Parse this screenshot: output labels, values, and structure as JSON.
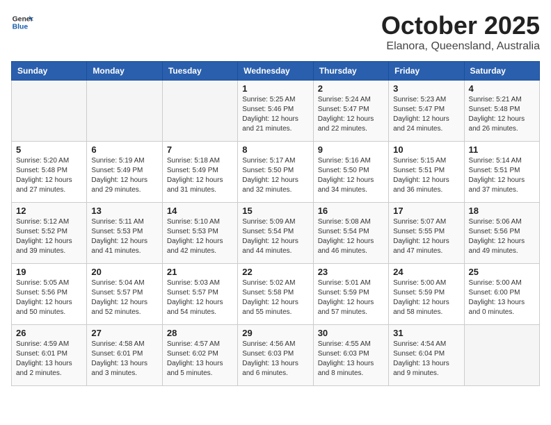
{
  "header": {
    "logo_general": "General",
    "logo_blue": "Blue",
    "month": "October 2025",
    "location": "Elanora, Queensland, Australia"
  },
  "weekdays": [
    "Sunday",
    "Monday",
    "Tuesday",
    "Wednesday",
    "Thursday",
    "Friday",
    "Saturday"
  ],
  "weeks": [
    [
      {
        "day": "",
        "sunrise": "",
        "sunset": "",
        "daylight": ""
      },
      {
        "day": "",
        "sunrise": "",
        "sunset": "",
        "daylight": ""
      },
      {
        "day": "",
        "sunrise": "",
        "sunset": "",
        "daylight": ""
      },
      {
        "day": "1",
        "sunrise": "Sunrise: 5:25 AM",
        "sunset": "Sunset: 5:46 PM",
        "daylight": "Daylight: 12 hours and 21 minutes."
      },
      {
        "day": "2",
        "sunrise": "Sunrise: 5:24 AM",
        "sunset": "Sunset: 5:47 PM",
        "daylight": "Daylight: 12 hours and 22 minutes."
      },
      {
        "day": "3",
        "sunrise": "Sunrise: 5:23 AM",
        "sunset": "Sunset: 5:47 PM",
        "daylight": "Daylight: 12 hours and 24 minutes."
      },
      {
        "day": "4",
        "sunrise": "Sunrise: 5:21 AM",
        "sunset": "Sunset: 5:48 PM",
        "daylight": "Daylight: 12 hours and 26 minutes."
      }
    ],
    [
      {
        "day": "5",
        "sunrise": "Sunrise: 5:20 AM",
        "sunset": "Sunset: 5:48 PM",
        "daylight": "Daylight: 12 hours and 27 minutes."
      },
      {
        "day": "6",
        "sunrise": "Sunrise: 5:19 AM",
        "sunset": "Sunset: 5:49 PM",
        "daylight": "Daylight: 12 hours and 29 minutes."
      },
      {
        "day": "7",
        "sunrise": "Sunrise: 5:18 AM",
        "sunset": "Sunset: 5:49 PM",
        "daylight": "Daylight: 12 hours and 31 minutes."
      },
      {
        "day": "8",
        "sunrise": "Sunrise: 5:17 AM",
        "sunset": "Sunset: 5:50 PM",
        "daylight": "Daylight: 12 hours and 32 minutes."
      },
      {
        "day": "9",
        "sunrise": "Sunrise: 5:16 AM",
        "sunset": "Sunset: 5:50 PM",
        "daylight": "Daylight: 12 hours and 34 minutes."
      },
      {
        "day": "10",
        "sunrise": "Sunrise: 5:15 AM",
        "sunset": "Sunset: 5:51 PM",
        "daylight": "Daylight: 12 hours and 36 minutes."
      },
      {
        "day": "11",
        "sunrise": "Sunrise: 5:14 AM",
        "sunset": "Sunset: 5:51 PM",
        "daylight": "Daylight: 12 hours and 37 minutes."
      }
    ],
    [
      {
        "day": "12",
        "sunrise": "Sunrise: 5:12 AM",
        "sunset": "Sunset: 5:52 PM",
        "daylight": "Daylight: 12 hours and 39 minutes."
      },
      {
        "day": "13",
        "sunrise": "Sunrise: 5:11 AM",
        "sunset": "Sunset: 5:53 PM",
        "daylight": "Daylight: 12 hours and 41 minutes."
      },
      {
        "day": "14",
        "sunrise": "Sunrise: 5:10 AM",
        "sunset": "Sunset: 5:53 PM",
        "daylight": "Daylight: 12 hours and 42 minutes."
      },
      {
        "day": "15",
        "sunrise": "Sunrise: 5:09 AM",
        "sunset": "Sunset: 5:54 PM",
        "daylight": "Daylight: 12 hours and 44 minutes."
      },
      {
        "day": "16",
        "sunrise": "Sunrise: 5:08 AM",
        "sunset": "Sunset: 5:54 PM",
        "daylight": "Daylight: 12 hours and 46 minutes."
      },
      {
        "day": "17",
        "sunrise": "Sunrise: 5:07 AM",
        "sunset": "Sunset: 5:55 PM",
        "daylight": "Daylight: 12 hours and 47 minutes."
      },
      {
        "day": "18",
        "sunrise": "Sunrise: 5:06 AM",
        "sunset": "Sunset: 5:56 PM",
        "daylight": "Daylight: 12 hours and 49 minutes."
      }
    ],
    [
      {
        "day": "19",
        "sunrise": "Sunrise: 5:05 AM",
        "sunset": "Sunset: 5:56 PM",
        "daylight": "Daylight: 12 hours and 50 minutes."
      },
      {
        "day": "20",
        "sunrise": "Sunrise: 5:04 AM",
        "sunset": "Sunset: 5:57 PM",
        "daylight": "Daylight: 12 hours and 52 minutes."
      },
      {
        "day": "21",
        "sunrise": "Sunrise: 5:03 AM",
        "sunset": "Sunset: 5:57 PM",
        "daylight": "Daylight: 12 hours and 54 minutes."
      },
      {
        "day": "22",
        "sunrise": "Sunrise: 5:02 AM",
        "sunset": "Sunset: 5:58 PM",
        "daylight": "Daylight: 12 hours and 55 minutes."
      },
      {
        "day": "23",
        "sunrise": "Sunrise: 5:01 AM",
        "sunset": "Sunset: 5:59 PM",
        "daylight": "Daylight: 12 hours and 57 minutes."
      },
      {
        "day": "24",
        "sunrise": "Sunrise: 5:00 AM",
        "sunset": "Sunset: 5:59 PM",
        "daylight": "Daylight: 12 hours and 58 minutes."
      },
      {
        "day": "25",
        "sunrise": "Sunrise: 5:00 AM",
        "sunset": "Sunset: 6:00 PM",
        "daylight": "Daylight: 13 hours and 0 minutes."
      }
    ],
    [
      {
        "day": "26",
        "sunrise": "Sunrise: 4:59 AM",
        "sunset": "Sunset: 6:01 PM",
        "daylight": "Daylight: 13 hours and 2 minutes."
      },
      {
        "day": "27",
        "sunrise": "Sunrise: 4:58 AM",
        "sunset": "Sunset: 6:01 PM",
        "daylight": "Daylight: 13 hours and 3 minutes."
      },
      {
        "day": "28",
        "sunrise": "Sunrise: 4:57 AM",
        "sunset": "Sunset: 6:02 PM",
        "daylight": "Daylight: 13 hours and 5 minutes."
      },
      {
        "day": "29",
        "sunrise": "Sunrise: 4:56 AM",
        "sunset": "Sunset: 6:03 PM",
        "daylight": "Daylight: 13 hours and 6 minutes."
      },
      {
        "day": "30",
        "sunrise": "Sunrise: 4:55 AM",
        "sunset": "Sunset: 6:03 PM",
        "daylight": "Daylight: 13 hours and 8 minutes."
      },
      {
        "day": "31",
        "sunrise": "Sunrise: 4:54 AM",
        "sunset": "Sunset: 6:04 PM",
        "daylight": "Daylight: 13 hours and 9 minutes."
      },
      {
        "day": "",
        "sunrise": "",
        "sunset": "",
        "daylight": ""
      }
    ]
  ]
}
